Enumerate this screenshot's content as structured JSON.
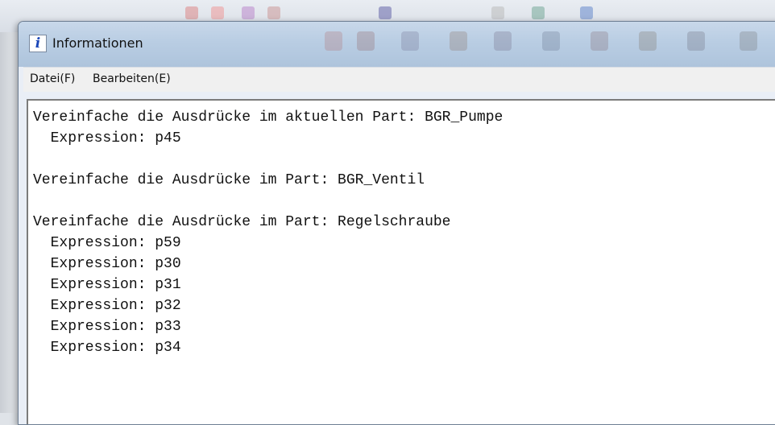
{
  "window": {
    "title": "Informationen",
    "icon": "info-icon"
  },
  "menu": {
    "items": [
      "Datei(F)",
      "Bearbeiten(E)"
    ]
  },
  "output": {
    "lines": [
      "Vereinfache die Ausdrücke im aktuellen Part: BGR_Pumpe",
      "  Expression: p45",
      "",
      "Vereinfache die Ausdrücke im Part: BGR_Ventil",
      "",
      "Vereinfache die Ausdrücke im Part: Regelschraube",
      "  Expression: p59",
      "  Expression: p30",
      "  Expression: p31",
      "  Expression: p32",
      "  Expression: p33",
      "  Expression: p34"
    ]
  }
}
